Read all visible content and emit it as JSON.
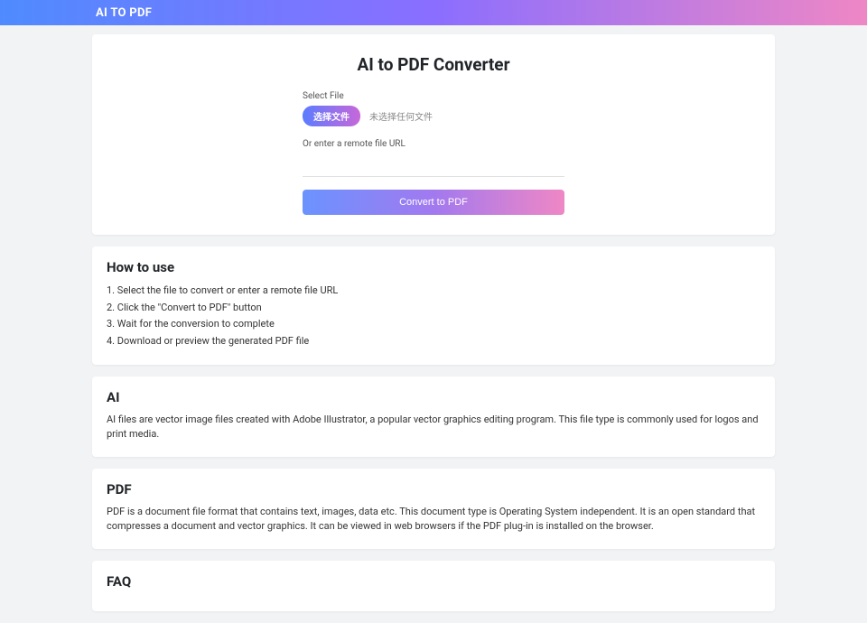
{
  "brand": "AI TO PDF",
  "main": {
    "title": "AI to PDF Converter",
    "select_label": "Select File",
    "choose_button": "选择文件",
    "file_status": "未选择任何文件",
    "or_label": "Or enter a remote file URL",
    "url_placeholder": "",
    "convert_button": "Convert to PDF"
  },
  "howto": {
    "title": "How to use",
    "steps": [
      "1. Select the file to convert or enter a remote file URL",
      "2. Click the \"Convert to PDF\" button",
      "3. Wait for the conversion to complete",
      "4. Download or preview the generated PDF file"
    ]
  },
  "ai_section": {
    "title": "AI",
    "desc": "AI files are vector image files created with Adobe Illustrator, a popular vector graphics editing program. This file type is commonly used for logos and print media."
  },
  "pdf_section": {
    "title": "PDF",
    "desc": "PDF is a document file format that contains text, images, data etc. This document type is Operating System independent. It is an open standard that compresses a document and vector graphics. It can be viewed in web browsers if the PDF plug-in is installed on the browser."
  },
  "faq": {
    "title": "FAQ"
  }
}
